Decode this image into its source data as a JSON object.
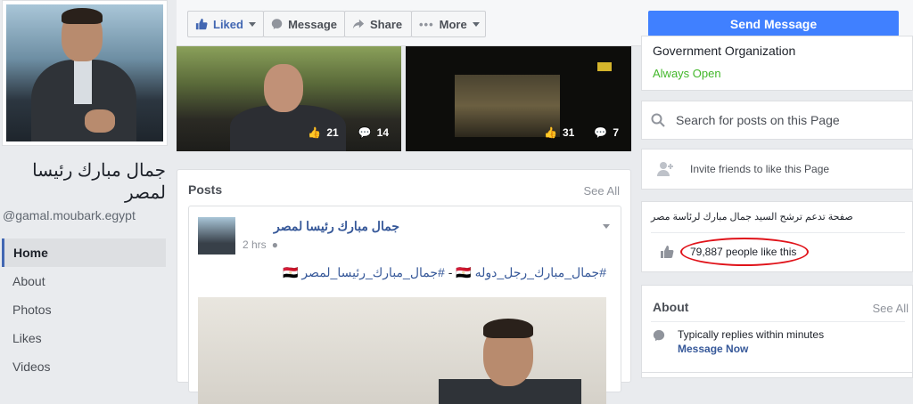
{
  "sidebar": {
    "page_name": "جمال مبارك رئيسا لمصر",
    "handle": "@gamal.moubark.egypt",
    "nav": [
      "Home",
      "About",
      "Photos",
      "Likes",
      "Videos"
    ]
  },
  "toolbar": {
    "liked_label": "Liked",
    "message_label": "Message",
    "share_label": "Share",
    "more_label": "More",
    "send_message_label": "Send Message"
  },
  "videos": [
    {
      "likes": "21",
      "comments": "14"
    },
    {
      "likes": "31",
      "comments": "7"
    }
  ],
  "posts": {
    "title": "Posts",
    "see_all": "See All",
    "post": {
      "author": "جمال مبارك رئيسا لمصر",
      "time": "2 hrs",
      "hashtag1": "#جمال_مبارك_رجل_دوله",
      "separator": "-",
      "hashtag2": "#جمال_مبارك_رئيسا_لمصر",
      "flag": "🇪🇬"
    }
  },
  "right": {
    "category": "Government Organization",
    "hours": "Always Open",
    "search_placeholder": "Search for posts on this Page",
    "invite": "Invite friends to like this Page",
    "description": "صفحة تدعم ترشح السيد جمال مبارك لرئاسة مصر",
    "likes": "79,887 people like this",
    "about_title": "About",
    "about_see_all": "See All",
    "replies": "Typically replies within minutes",
    "message_now": "Message Now"
  },
  "colors": {
    "accent": "#4080ff",
    "link": "#365899",
    "open_green": "#42b72a",
    "highlight_red": "#e0131a"
  }
}
